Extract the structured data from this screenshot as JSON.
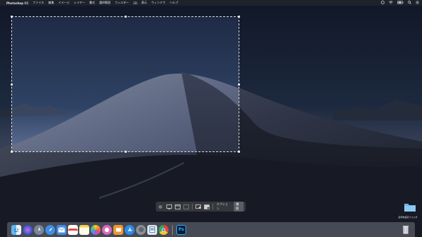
{
  "menubar": {
    "app_name": "Photoshop CC",
    "items": [
      "ファイル",
      "編集",
      "イメージ",
      "レイヤー",
      "書式",
      "選択範囲",
      "フィルター",
      "3D",
      "表示",
      "ウィンドウ",
      "ヘルプ"
    ]
  },
  "capture_toolbar": {
    "options_label": "オプション",
    "capture_label": "撮影"
  },
  "desktop": {
    "folder_label": "名称未設定フォルダ"
  },
  "dock": {
    "apps": [
      "finder",
      "siri",
      "launchpad",
      "safari",
      "mail",
      "calendar",
      "notes",
      "photos",
      "itunes",
      "books",
      "app-store",
      "system-preferences",
      "preview",
      "chrome",
      "photoshop"
    ]
  },
  "colors": {
    "sky_top": "#1e2a44",
    "sky_bottom": "#3f5577",
    "dune_light": "#8c96aa",
    "dune_dark": "#2b3142",
    "folder": "#6fb6e8"
  }
}
